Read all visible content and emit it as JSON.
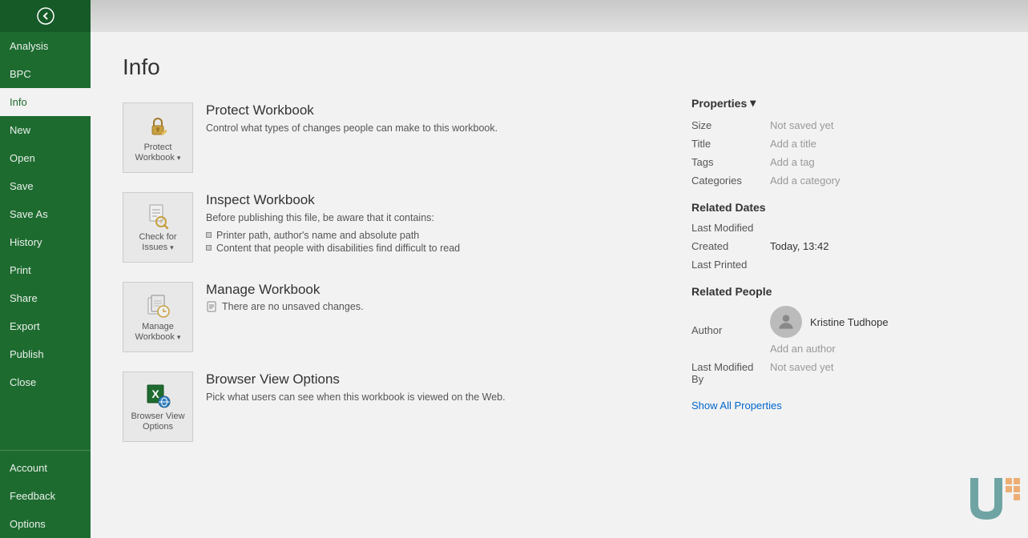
{
  "sidebar": {
    "back_label": "←",
    "items": [
      {
        "id": "analysis",
        "label": "Analysis",
        "active": false
      },
      {
        "id": "bpc",
        "label": "BPC",
        "active": false
      },
      {
        "id": "info",
        "label": "Info",
        "active": true
      },
      {
        "id": "new",
        "label": "New",
        "active": false
      },
      {
        "id": "open",
        "label": "Open",
        "active": false
      },
      {
        "id": "save",
        "label": "Save",
        "active": false
      },
      {
        "id": "save-as",
        "label": "Save As",
        "active": false
      },
      {
        "id": "history",
        "label": "History",
        "active": false
      },
      {
        "id": "print",
        "label": "Print",
        "active": false
      },
      {
        "id": "share",
        "label": "Share",
        "active": false
      },
      {
        "id": "export",
        "label": "Export",
        "active": false
      },
      {
        "id": "publish",
        "label": "Publish",
        "active": false
      },
      {
        "id": "close",
        "label": "Close",
        "active": false
      }
    ],
    "bottom_items": [
      {
        "id": "account",
        "label": "Account",
        "active": false
      },
      {
        "id": "feedback",
        "label": "Feedback",
        "active": false
      },
      {
        "id": "options",
        "label": "Options",
        "active": false
      }
    ]
  },
  "main": {
    "title": "Info",
    "cards": [
      {
        "id": "protect",
        "icon_label": "Protect\nWorkbook",
        "has_arrow": true,
        "title": "Protect Workbook",
        "description": "Control what types of changes people can make to this workbook."
      },
      {
        "id": "inspect",
        "icon_label": "Check for\nIssues",
        "has_arrow": true,
        "title": "Inspect Workbook",
        "description": "Before publishing this file, be aware that it contains:",
        "bullets": [
          "Printer path, author's name and absolute path",
          "Content that people with disabilities find difficult to read"
        ]
      },
      {
        "id": "manage",
        "icon_label": "Manage\nWorkbook",
        "has_arrow": true,
        "title": "Manage Workbook",
        "note": "There are no unsaved changes."
      },
      {
        "id": "browser",
        "icon_label": "Browser View\nOptions",
        "has_arrow": false,
        "title": "Browser View Options",
        "description": "Pick what users can see when this workbook is viewed on the Web."
      }
    ]
  },
  "properties": {
    "header": "Properties",
    "rows": [
      {
        "label": "Size",
        "value": "Not saved yet"
      },
      {
        "label": "Title",
        "value": "Add a title"
      },
      {
        "label": "Tags",
        "value": "Add a tag"
      },
      {
        "label": "Categories",
        "value": "Add a category"
      }
    ]
  },
  "related_dates": {
    "header": "Related Dates",
    "rows": [
      {
        "label": "Last Modified",
        "value": ""
      },
      {
        "label": "Created",
        "value": "Today, 13:42"
      },
      {
        "label": "Last Printed",
        "value": ""
      }
    ]
  },
  "related_people": {
    "header": "Related People",
    "author_label": "Author",
    "author_name": "Kristine Tudhope",
    "add_author": "Add an author",
    "last_modified_by_label": "Last Modified By",
    "last_modified_by_value": "Not saved yet",
    "show_all": "Show All Properties"
  }
}
